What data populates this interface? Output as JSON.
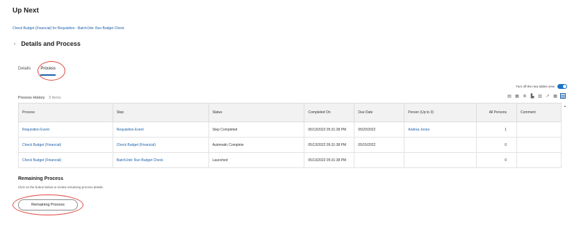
{
  "page": {
    "title": "Up Next",
    "breadcrumb": "Check Budget (Financial) for Requisition - Batch/Job: Run Budget Check"
  },
  "section": {
    "title": "Details and Process"
  },
  "tabs": [
    {
      "label": "Details"
    },
    {
      "label": "Process"
    }
  ],
  "toggle": {
    "label": "Turn off the new tables view"
  },
  "process_history": {
    "title": "Process History",
    "count": "3 items"
  },
  "table": {
    "headers": [
      "Process",
      "Step",
      "Status",
      "Completed On",
      "Due Date",
      "Person (Up to 3)",
      "All Persons",
      "Comment"
    ],
    "rows": [
      [
        "Requisition Event",
        "Requisition Event",
        "Step Completed",
        "05/13/2022 05:31:38 PM",
        "05/20/2022",
        "Andrea Jones",
        "1",
        ""
      ],
      [
        "Check Budget (Financial)",
        "Check Budget (Financial)",
        "Automatic Complete",
        "05/13/2022 05:31:38 PM",
        "05/15/2022",
        "",
        "0",
        ""
      ],
      [
        "Check Budget (Financial)",
        "Batch/Job: Run Budget Check",
        "Launched",
        "05/13/2022 05:31:38 PM",
        "",
        "",
        "0",
        ""
      ]
    ]
  },
  "remaining": {
    "title": "Remaining Process",
    "subtitle": "Click on the button below to review remaining process details.",
    "button_label": "Remaining Process"
  },
  "colors": {
    "link": "#1a5ea8",
    "annotation": "#e0443b",
    "accent": "#1a73c8"
  }
}
